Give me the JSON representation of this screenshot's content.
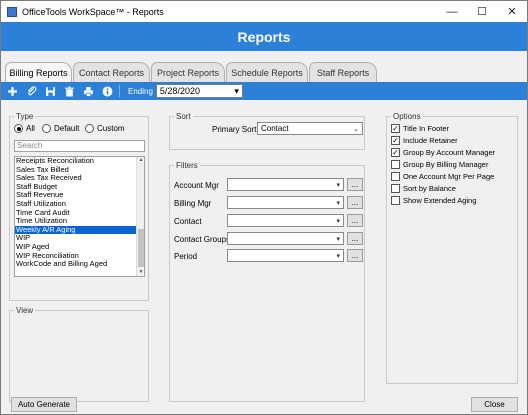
{
  "window": {
    "title": "OfficeTools WorkSpace™ - Reports",
    "minimize_glyph": "—",
    "maximize_glyph": "☐",
    "close_glyph": "✕"
  },
  "header": {
    "title": "Reports"
  },
  "tabs": [
    {
      "label": "Billing Reports",
      "active": true
    },
    {
      "label": "Contact Reports",
      "active": false
    },
    {
      "label": "Project Reports",
      "active": false
    },
    {
      "label": "Schedule Reports",
      "active": false
    },
    {
      "label": "Staff Reports",
      "active": false
    }
  ],
  "toolbar": {
    "icons": [
      "add-icon",
      "attach-icon",
      "save-icon",
      "delete-icon",
      "print-icon",
      "info-icon"
    ],
    "ending_label": "Ending",
    "ending_value": "5/28/2020"
  },
  "type_group": {
    "label": "Type",
    "radios": [
      {
        "label": "All",
        "selected": true
      },
      {
        "label": "Default",
        "selected": false
      },
      {
        "label": "Custom",
        "selected": false
      }
    ],
    "search_placeholder": "Search",
    "items": [
      "Receipts Reconciliation",
      "Sales Tax Billed",
      "Sales Tax Received",
      "Staff Budget",
      "Staff Revenue",
      "Staff Utilization",
      "Time Card Audit",
      "Time Utilization",
      "Weekly A/R Aging",
      "WIP",
      "WIP Aged",
      "WIP Reconciliation",
      "WorkCode and Billing Aged"
    ],
    "selected_index": 8
  },
  "view_group": {
    "label": "View"
  },
  "sort_group": {
    "label": "Sort",
    "primary_sort_label": "Primary Sort",
    "primary_sort_value": "Contact"
  },
  "filters_group": {
    "label": "Filters",
    "fields": [
      {
        "label": "Account Mgr",
        "value": "",
        "button": "..."
      },
      {
        "label": "Billing Mgr",
        "value": "",
        "button": "..."
      },
      {
        "label": "Contact",
        "value": "",
        "button": "..."
      },
      {
        "label": "Contact Groups",
        "value": "",
        "button": "..."
      },
      {
        "label": "Period",
        "value": "",
        "button": "..."
      }
    ]
  },
  "options_group": {
    "label": "Options",
    "checks": [
      {
        "label": "Title In Footer",
        "checked": true
      },
      {
        "label": "Include Retainer",
        "checked": true
      },
      {
        "label": "Group By Account Manager",
        "checked": true
      },
      {
        "label": "Group By Billing Manager",
        "checked": false
      },
      {
        "label": "One Account Mgr Per Page",
        "checked": false
      },
      {
        "label": "Sort by Balance",
        "checked": false
      },
      {
        "label": "Show Extended Aging",
        "checked": false
      }
    ]
  },
  "footer": {
    "auto_generate_label": "Auto Generate",
    "close_label": "Close"
  },
  "colors": {
    "accent_blue": "#2d80d8",
    "selection_blue": "#0a64d6"
  }
}
